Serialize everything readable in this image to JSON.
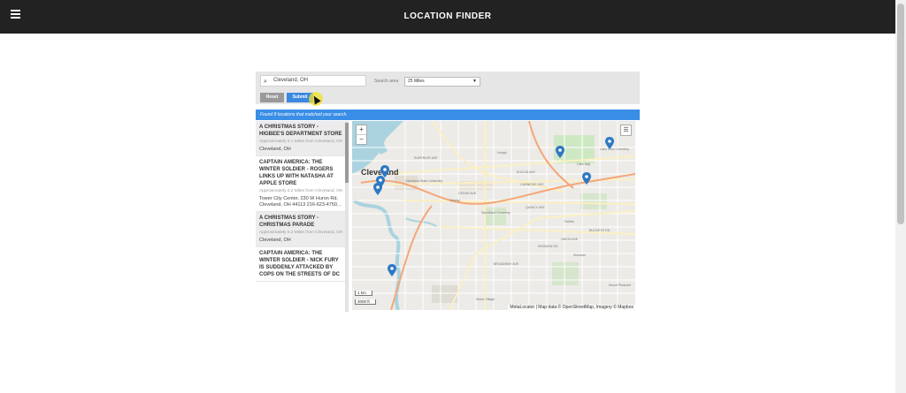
{
  "app": {
    "title": "LOCATION FINDER"
  },
  "search": {
    "location_value": "Cleveland, OH",
    "area_label": "Search area",
    "area_value": "25 Miles",
    "reset_label": "Reset",
    "submit_label": "Submit"
  },
  "status": {
    "message": "Found 8 locations that matched your search."
  },
  "results": [
    {
      "title": "A CHRISTMAS STORY - HIGBEE'S DEPARTMENT STORE",
      "distance": "Approximately 0.1 Miles from Cleveland, OH",
      "address": "Cleveland, OH"
    },
    {
      "title": "CAPTAIN AMERICA: THE WINTER SOLDIER - ROGERS LINKS UP WITH NATASHA AT APPLE STORE",
      "distance": "Approximately 0.2 Miles from Cleveland, OH",
      "address": "Tower City Center, 230 W Huron Rd, Cleveland, OH 44113 216-623-4750, ,"
    },
    {
      "title": "A CHRISTMAS STORY - CHRISTMAS PARADE",
      "distance": "Approximately 0.2 Miles from Cleveland, OH",
      "address": "Cleveland, OH"
    },
    {
      "title": "CAPTAIN AMERICA: THE WINTER SOLDIER - NICK FURY IS SUDDENLY ATTACKED BY COPS ON THE STREETS OF DC",
      "distance": "",
      "address": ""
    }
  ],
  "map": {
    "city_label": "Cleveland",
    "zoom_in": "+",
    "zoom_out": "−",
    "layers_icon": "layers-icon",
    "scale_km": "1 km",
    "scale_ft": "3000 ft",
    "attribution": "MetaLocator | Map data © OpenStreetMap, Imagery © Mapbox",
    "street_labels": [
      "Cleveland State University",
      "Woodland Cemetery",
      "Hough",
      "Little Italy",
      "Lake View Cemetery",
      "Slavic Village",
      "Kinsman",
      "Fairfax",
      "Mount Pleasant",
      "Central",
      "CARNEGIE AVE",
      "CEDAR AVE",
      "EUCLID AVE",
      "SUPERIOR AVE",
      "QUINCY AVE",
      "KINSMAN RD",
      "BROADWAY AVE",
      "UNION AVE",
      "BUCKEYE RD"
    ],
    "marker_color": "#2e78c4"
  },
  "colors": {
    "accent": "#3a8ee6",
    "topbar": "#222222",
    "submit": "#3b88e0",
    "reset": "#999999"
  }
}
